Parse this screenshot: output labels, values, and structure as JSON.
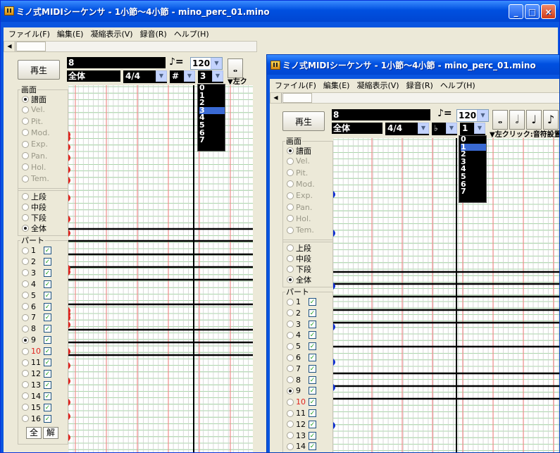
{
  "window": {
    "title": "ミノ式MIDIシーケンサ - 1小節～4小節 - mino_perc_01.mino"
  },
  "title_buttons": {
    "minimize": "_",
    "maximize": "□",
    "close": "×"
  },
  "menu": [
    "ファイル(F)",
    "編集(E)",
    "凝縮表示(V)",
    "録音(R)",
    "ヘルプ(H)"
  ],
  "scroll_arrow": "◀",
  "toolbar": {
    "play": "再生",
    "track": "8",
    "staff_sel": "全体",
    "time_sig": "4/4",
    "tempo_prefix": "♪=",
    "tempo": "120",
    "back_accidental": "#",
    "back_octave": "3",
    "front_accidental": "♭",
    "front_octave": "1",
    "hint": "▼左クリック:音符設置",
    "back_hint": "▼左ク",
    "notes": [
      "𝅝",
      "𝅗𝅥",
      "♩",
      "♪"
    ]
  },
  "octave_list": [
    "0",
    "1",
    "2",
    "3",
    "4",
    "5",
    "6",
    "7"
  ],
  "back_list_selected": "3",
  "front_list_selected": "1",
  "screen_group": {
    "legend": "画面",
    "options": [
      "譜面",
      "Vel.",
      "Pit.",
      "Mod.",
      "Exp.",
      "Pan.",
      "Hol.",
      "Tem."
    ],
    "selected": "譜面"
  },
  "staff_group": {
    "options": [
      "上段",
      "中段",
      "下段",
      "全体"
    ],
    "selected": "全体"
  },
  "part_group": {
    "legend": "パート",
    "parts": [
      "1",
      "2",
      "3",
      "4",
      "5",
      "6",
      "7",
      "8",
      "9",
      "10",
      "11",
      "12",
      "13",
      "14",
      "15",
      "16"
    ],
    "selected": "9",
    "red_part": "10",
    "all_button": "全",
    "clear_button": "解"
  },
  "colors": {
    "title_blue": "#0a55e0",
    "grid_red": "#f08c8c",
    "grid_green": "#8cc88c",
    "note_red": "#e0241f",
    "note_blue": "#1030d0"
  }
}
